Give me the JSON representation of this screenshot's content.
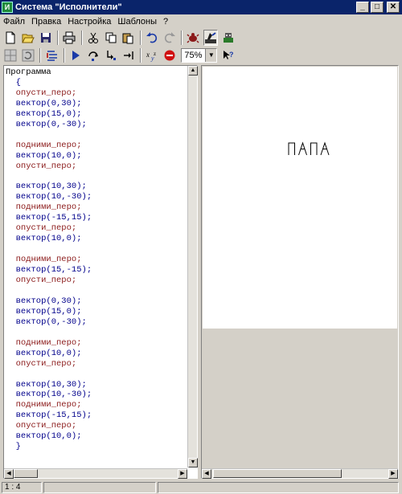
{
  "window": {
    "title": "Система \"Исполнители\"",
    "min_label": "_",
    "max_label": "□",
    "close_label": "✕"
  },
  "menu": [
    "Файл",
    "Правка",
    "Настройка",
    "Шаблоны",
    "?"
  ],
  "toolbar": {
    "zoom_value": "75%"
  },
  "editor": {
    "lines": [
      {
        "text": "Программа",
        "cls": "kw"
      },
      {
        "text": "  {",
        "cls": "nv"
      },
      {
        "text": "  опусти_перо;",
        "cls": "dr"
      },
      {
        "text": "  вектор(0,30);",
        "cls": "nv"
      },
      {
        "text": "  вектор(15,0);",
        "cls": "nv"
      },
      {
        "text": "  вектор(0,-30);",
        "cls": "nv"
      },
      {
        "text": "",
        "cls": "blank"
      },
      {
        "text": "  подними_перо;",
        "cls": "dr"
      },
      {
        "text": "  вектор(10,0);",
        "cls": "nv"
      },
      {
        "text": "  опусти_перо;",
        "cls": "dr"
      },
      {
        "text": "",
        "cls": "blank"
      },
      {
        "text": "  вектор(10,30);",
        "cls": "nv"
      },
      {
        "text": "  вектор(10,-30);",
        "cls": "nv"
      },
      {
        "text": "  подними_перо;",
        "cls": "dr"
      },
      {
        "text": "  вектор(-15,15);",
        "cls": "nv"
      },
      {
        "text": "  опусти_перо;",
        "cls": "dr"
      },
      {
        "text": "  вектор(10,0);",
        "cls": "nv"
      },
      {
        "text": "",
        "cls": "blank"
      },
      {
        "text": "  подними_перо;",
        "cls": "dr"
      },
      {
        "text": "  вектор(15,-15);",
        "cls": "nv"
      },
      {
        "text": "  опусти_перо;",
        "cls": "dr"
      },
      {
        "text": "",
        "cls": "blank"
      },
      {
        "text": "  вектор(0,30);",
        "cls": "nv"
      },
      {
        "text": "  вектор(15,0);",
        "cls": "nv"
      },
      {
        "text": "  вектор(0,-30);",
        "cls": "nv"
      },
      {
        "text": "",
        "cls": "blank"
      },
      {
        "text": "  подними_перо;",
        "cls": "dr"
      },
      {
        "text": "  вектор(10,0);",
        "cls": "nv"
      },
      {
        "text": "  опусти_перо;",
        "cls": "dr"
      },
      {
        "text": "",
        "cls": "blank"
      },
      {
        "text": "  вектор(10,30);",
        "cls": "nv"
      },
      {
        "text": "  вектор(10,-30);",
        "cls": "nv"
      },
      {
        "text": "  подними_перо;",
        "cls": "dr"
      },
      {
        "text": "  вектор(-15,15);",
        "cls": "nv"
      },
      {
        "text": "  опусти_перо;",
        "cls": "dr"
      },
      {
        "text": "  вектор(10,0);",
        "cls": "nv"
      },
      {
        "text": "  }",
        "cls": "nv"
      }
    ]
  },
  "drawing": {
    "pen_color": "#000000"
  },
  "status": {
    "position": "1 : 4"
  },
  "colors": {
    "titlebar": "#0a246a",
    "directive": "#8b1a1a",
    "command": "#00008b"
  }
}
